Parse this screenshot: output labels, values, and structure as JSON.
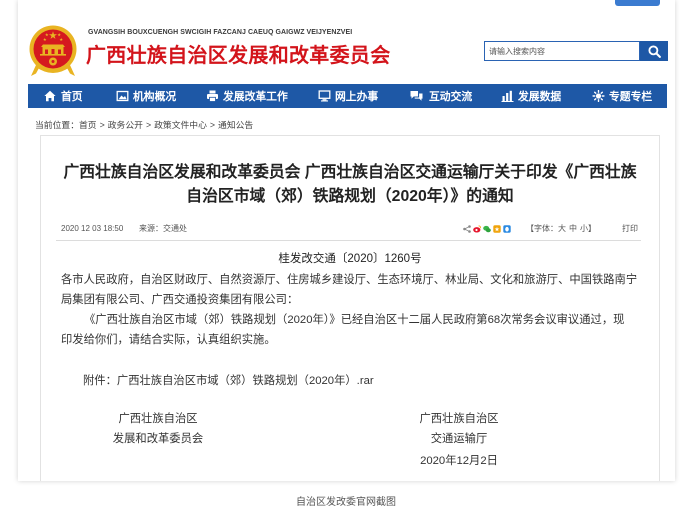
{
  "colors": {
    "brand_red": "#d3141b",
    "nav_blue": "#1e58a6",
    "emblem_gold": "#e9b422",
    "emblem_red": "#d51a1f"
  },
  "header": {
    "logo_icon": "national-emblem-icon",
    "pinyin_title": "GVANGSIH BOUXCUENGH SWCIGIH FAZCANJ CAEUQ GAIGWZ VEIJYENZVEI",
    "title": "广西壮族自治区发展和改革委员会",
    "search": {
      "placeholder": "请输入搜索内容",
      "button_icon": "search-icon"
    }
  },
  "nav": {
    "items": [
      {
        "label": "首页",
        "icon": "home-icon"
      },
      {
        "label": "机构概况",
        "icon": "image-icon"
      },
      {
        "label": "发展改革工作",
        "icon": "printer-icon"
      },
      {
        "label": "网上办事",
        "icon": "monitor-icon"
      },
      {
        "label": "互动交流",
        "icon": "chat-icon"
      },
      {
        "label": "发展数据",
        "icon": "bar-chart-icon"
      },
      {
        "label": "专题专栏",
        "icon": "gear-icon"
      }
    ]
  },
  "breadcrumb": {
    "prefix": "当前位置：",
    "separator": ">",
    "items": [
      "首页",
      "政务公开",
      "政策文件中心",
      "通知公告"
    ]
  },
  "article": {
    "title_lines": [
      "广西壮族自治区发展和改革委员会 广西壮族自治区交通运输厅关于印发《广西壮族",
      "自治区市域（郊）铁路规划（2020年）》的通知"
    ],
    "meta": {
      "date": "2020 12 03 18:50",
      "source": "来源：交通处",
      "share_icons": [
        "share-icon",
        "weibo-icon",
        "wechat-icon",
        "qzone-icon",
        "qq-icon"
      ],
      "font_size_label_open": "【字体：",
      "font_sizes": [
        "大",
        "中",
        "小"
      ],
      "font_size_label_close": "】",
      "print_label": "打印"
    },
    "doc_number": "桂发改交通〔2020〕1260号",
    "recipients_lines": [
      "各市人民政府，自治区财政厅、自然资源厅、住房城乡建设厅、生态环境厅、林业局、文化和旅游厅、中国铁路南宁",
      "局集团有限公司、广西交通投资集团有限公司："
    ],
    "body_lines": [
      "《广西壮族自治区市域（郊）铁路规划（2020年）》已经自治区十二届人民政府第68次常务会议审议通过，现",
      "印发给你们，请结合实际，认真组织实施。"
    ],
    "attachment": {
      "label": "附件：",
      "file": "广西壮族自治区市域（郊）铁路规划（2020年）.rar"
    },
    "signatures": {
      "left": [
        "广西壮族自治区",
        "发展和改革委员会"
      ],
      "right": [
        "广西壮族自治区",
        "交通运输厅"
      ],
      "date": "2020年12月2日"
    }
  },
  "caption": "自治区发改委官网截图"
}
